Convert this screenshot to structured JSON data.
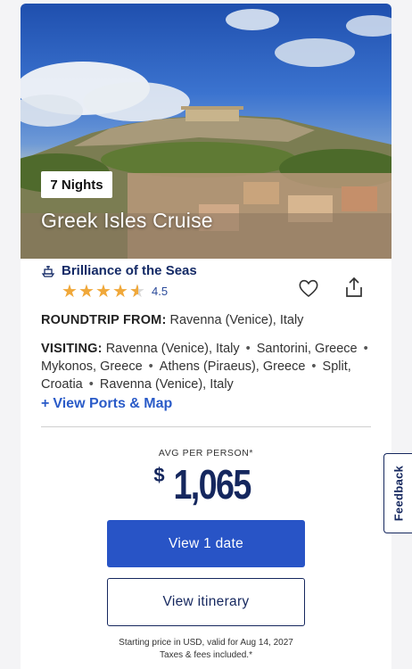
{
  "card": {
    "nights_badge": "7 Nights",
    "title": "Greek Isles Cruise",
    "ship_icon": "ship-icon",
    "ship_name": "Brilliance of the Seas",
    "rating": 4.5,
    "rating_text": "4.5",
    "stars_max": 5,
    "heart_icon": "heart-icon",
    "share_icon": "share-icon",
    "roundtrip_label": "ROUNDTRIP FROM:",
    "roundtrip_value": "Ravenna (Venice), Italy",
    "visiting_label": "VISITING:",
    "ports": [
      "Ravenna (Venice), Italy",
      "Santorini, Greece",
      "Mykonos, Greece",
      "Athens (Piraeus), Greece",
      "Split, Croatia",
      "Ravenna (Venice), Italy"
    ],
    "view_ports_link": "View Ports & Map",
    "avg_label": "AVG PER PERSON*",
    "price_currency": "$",
    "price_amount": "1,065",
    "primary_button": "View 1 date",
    "secondary_button": "View itinerary",
    "fine_print_line1": "Starting price in USD, valid for Aug 14, 2027",
    "fine_print_line2": "Taxes & fees included.*"
  },
  "feedback_tab": "Feedback",
  "colors": {
    "brand_navy": "#15275e",
    "primary_blue": "#2854c6",
    "star": "#f0a83a",
    "link": "#2a5bc8"
  }
}
